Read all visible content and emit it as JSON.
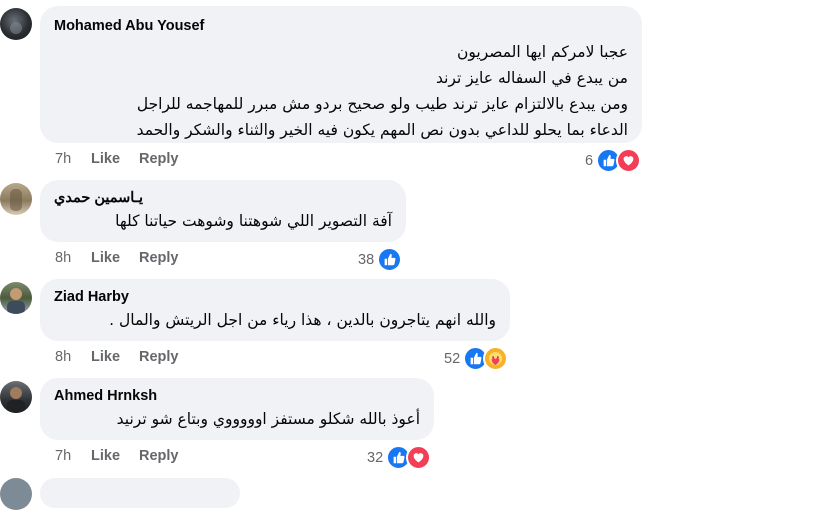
{
  "comments": [
    {
      "author": "Mohamed Abu Yousef",
      "lines": [
        "عجبا لامركم ايها المصريون",
        "من يبدع في السفاله عايز ترند",
        "ومن يبدع بالالتزام عايز ترند طيب ولو صحيح بردو مش مبرر للمهاجمه للراجل",
        "الدعاء بما يحلو للداعي بدون نص المهم يكون فيه الخير والثناء والشكر والحمد"
      ],
      "time": "7h",
      "like_label": "Like",
      "reply_label": "Reply",
      "reaction_count": "6",
      "reactions": [
        "like-icon",
        "love-icon"
      ]
    },
    {
      "author": "يـاسمين حمدي",
      "lines": [
        "آفة التصوير اللي شوهتنا وشوهت حياتنا كلها"
      ],
      "time": "8h",
      "like_label": "Like",
      "reply_label": "Reply",
      "reaction_count": "38",
      "reactions": [
        "like-icon"
      ]
    },
    {
      "author": "Ziad Harby",
      "lines": [
        "والله انهم يتاجرون بالدين ، هذا رياء من اجل الريتش والمال ."
      ],
      "time": "8h",
      "like_label": "Like",
      "reply_label": "Reply",
      "reaction_count": "52",
      "reactions": [
        "like-icon",
        "care-icon"
      ]
    },
    {
      "author": "Ahmed Hrnksh",
      "lines": [
        "أعوذ بالله شكلو مستفز اوووووي وبتاع شو ترنيد"
      ],
      "time": "7h",
      "like_label": "Like",
      "reply_label": "Reply",
      "reaction_count": "32",
      "reactions": [
        "like-icon",
        "love-icon"
      ]
    }
  ],
  "colors": {
    "bubble": "#f0f2f5",
    "meta_text": "#65676b",
    "like": "#1877f2",
    "love": "#f33e58",
    "care": "#f7b125"
  }
}
